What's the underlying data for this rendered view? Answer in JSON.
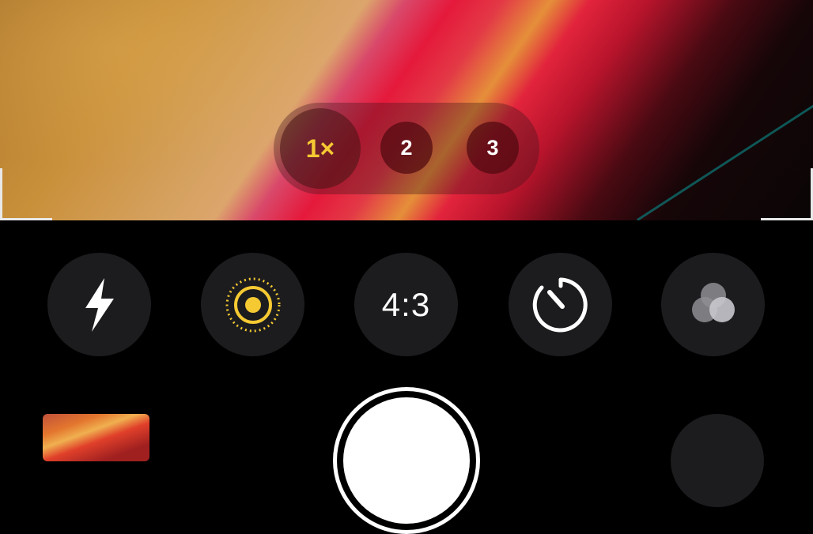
{
  "zoom": {
    "options": [
      "1×",
      "2",
      "3"
    ],
    "selected": "1×",
    "selected_color": "#f5c932"
  },
  "controls": {
    "flash_icon": "flash-icon",
    "live_photo_icon": "live-photo-icon",
    "aspect_ratio_label": "4:3",
    "timer_icon": "timer-icon",
    "filters_icon": "filters-icon"
  },
  "bottom_bar": {
    "thumbnail": "last-photo-thumbnail",
    "shutter": "shutter-button",
    "switch_camera": "switch-camera-button"
  },
  "colors": {
    "background": "#000000",
    "control_bg": "#1c1c1e",
    "accent": "#f5c932"
  }
}
